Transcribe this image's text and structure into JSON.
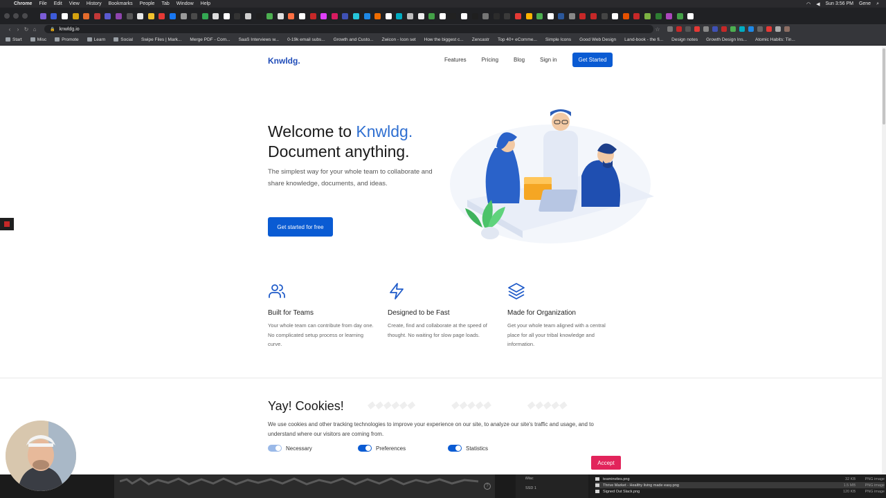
{
  "system_menubar": {
    "app": "Chrome",
    "menus": [
      "File",
      "Edit",
      "View",
      "History",
      "Bookmarks",
      "People",
      "Tab",
      "Window",
      "Help"
    ],
    "clock": "Sun 3:56 PM",
    "user": "Gene"
  },
  "browser": {
    "url": "knwldg.io",
    "bookmarks": [
      "Start",
      "Misc",
      "Promote",
      "Learn",
      "Social",
      "Swipe Files | Mark...",
      "Merge PDF - Com...",
      "SaaS Interviews w...",
      "0-19k email subs...",
      "Growth and Custo...",
      "Zwicon - Icon set",
      "How the biggest c...",
      "Zencastr",
      "Top 40+ eComme...",
      "Simple Icons",
      "Good Web Design",
      "Land-book - the fi...",
      "Design notes",
      "Growth Design Ins...",
      "Atomic Habits: Tin..."
    ]
  },
  "site": {
    "logo": "Knwldg.",
    "nav": {
      "features": "Features",
      "pricing": "Pricing",
      "blog": "Blog",
      "signin": "Sign in",
      "cta": "Get Started"
    },
    "hero": {
      "title_prefix": "Welcome to ",
      "title_brand": "Knwldg.",
      "title_line2": "Document anything.",
      "subtitle": "The simplest way for your whole team to collaborate and share knowledge, documents, and ideas.",
      "button": "Get started for free"
    },
    "features": [
      {
        "icon": "users-icon",
        "title": "Built for Teams",
        "text": "Your whole team can contribute from day one. No complicated setup process or learning curve."
      },
      {
        "icon": "lightning-icon",
        "title": "Designed to be Fast",
        "text": "Create, find and collaborate at the speed of thought. No waiting for slow page loads."
      },
      {
        "icon": "layers-icon",
        "title": "Made for Organization",
        "text": "Get your whole team aligned with a central place for all your tribal knowledge and information."
      }
    ],
    "cookie": {
      "title": "Yay! Cookies!",
      "text": "We use cookies and other tracking technologies to improve your experience on our site, to analyze our site's traffic and usage, and to understand where our visitors are coming from.",
      "toggles": [
        {
          "label": "Necessary",
          "on": true,
          "disabled": true
        },
        {
          "label": "Preferences",
          "on": true,
          "disabled": false
        },
        {
          "label": "Statistics",
          "on": true,
          "disabled": false
        }
      ],
      "accept": "Accept"
    }
  },
  "desktop": {
    "finder_items": [
      "iMac",
      "SSD 1"
    ],
    "files": [
      {
        "name": "teaminvites.png",
        "size": "32 KB",
        "kind": "PNG image"
      },
      {
        "name": "Thrive Market - Healthy living made easy.png",
        "size": "1.5 MB",
        "kind": "PNG image"
      },
      {
        "name": "Signed Out  Slack.png",
        "size": "120 KB",
        "kind": "PNG image"
      }
    ]
  },
  "colors": {
    "primary": "#0a5bd3",
    "brand_blue": "#2f6fd1",
    "accept": "#e2245b"
  }
}
